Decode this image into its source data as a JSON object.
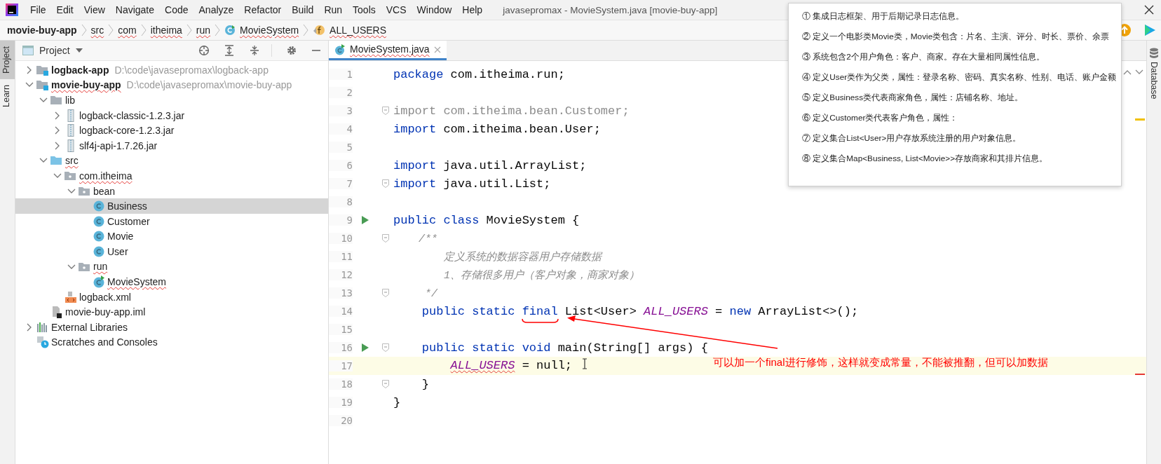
{
  "window": {
    "title": "javasepromax - MovieSystem.java [movie-buy-app]"
  },
  "menu": [
    "File",
    "Edit",
    "View",
    "Navigate",
    "Code",
    "Analyze",
    "Refactor",
    "Build",
    "Run",
    "Tools",
    "VCS",
    "Window",
    "Help"
  ],
  "breadcrumbs": [
    {
      "label": "movie-buy-app",
      "kind": "project",
      "error": false
    },
    {
      "label": "src",
      "kind": "dir",
      "error": true
    },
    {
      "label": "com",
      "kind": "dir",
      "error": true
    },
    {
      "label": "itheima",
      "kind": "dir",
      "error": true
    },
    {
      "label": "run",
      "kind": "dir",
      "error": true
    },
    {
      "label": "MovieSystem",
      "kind": "class",
      "error": true
    },
    {
      "label": "ALL_USERS",
      "kind": "field",
      "error": true
    }
  ],
  "left_stripe": [
    {
      "label": "Project",
      "selected": true
    },
    {
      "label": "Learn",
      "selected": false
    }
  ],
  "project_panel": {
    "title": "Project",
    "tree": [
      {
        "label": "logback-app",
        "path": "D:\\code\\javasepromax\\logback-app",
        "kind": "module",
        "expanded": false,
        "selected": false,
        "error": false
      },
      {
        "label": "movie-buy-app",
        "path": "D:\\code\\javasepromax\\movie-buy-app",
        "kind": "module",
        "expanded": true,
        "selected": false,
        "error": true,
        "children": [
          {
            "label": "lib",
            "kind": "folder",
            "expanded": true,
            "selected": false,
            "error": false,
            "children": [
              {
                "label": "logback-classic-1.2.3.jar",
                "kind": "jar",
                "expanded": false,
                "selected": false,
                "error": false
              },
              {
                "label": "logback-core-1.2.3.jar",
                "kind": "jar",
                "expanded": false,
                "selected": false,
                "error": false
              },
              {
                "label": "slf4j-api-1.7.26.jar",
                "kind": "jar",
                "expanded": false,
                "selected": false,
                "error": false
              }
            ]
          },
          {
            "label": "src",
            "kind": "source-folder",
            "expanded": true,
            "selected": false,
            "error": true,
            "children": [
              {
                "label": "com.itheima",
                "kind": "package",
                "expanded": true,
                "selected": false,
                "error": true,
                "children": [
                  {
                    "label": "bean",
                    "kind": "package",
                    "expanded": true,
                    "selected": false,
                    "error": false,
                    "children": [
                      {
                        "label": "Business",
                        "kind": "class",
                        "selected": true,
                        "error": false
                      },
                      {
                        "label": "Customer",
                        "kind": "class",
                        "selected": false,
                        "error": false
                      },
                      {
                        "label": "Movie",
                        "kind": "class",
                        "selected": false,
                        "error": false
                      },
                      {
                        "label": "User",
                        "kind": "class",
                        "selected": false,
                        "error": false
                      }
                    ]
                  },
                  {
                    "label": "run",
                    "kind": "package",
                    "expanded": true,
                    "selected": false,
                    "error": true,
                    "children": [
                      {
                        "label": "MovieSystem",
                        "kind": "main-class",
                        "selected": false,
                        "error": true
                      }
                    ]
                  }
                ]
              },
              {
                "label": "logback.xml",
                "kind": "xml",
                "selected": false,
                "error": false
              }
            ]
          },
          {
            "label": "movie-buy-app.iml",
            "kind": "iml",
            "selected": false,
            "error": false
          }
        ]
      },
      {
        "label": "External Libraries",
        "kind": "libraries",
        "expanded": false,
        "selected": false,
        "error": false
      },
      {
        "label": "Scratches and Consoles",
        "kind": "scratches",
        "selected": false,
        "error": false
      }
    ]
  },
  "editor": {
    "tabs": [
      {
        "label": "MovieSystem.java",
        "selected": true,
        "error": true
      }
    ],
    "lines": [
      {
        "number": "1",
        "kind": "code",
        "run": false,
        "fold": false,
        "current": false,
        "tokens": [
          {
            "t": "package",
            "kind": "keyword"
          },
          {
            "t": " com.itheima.run;",
            "kind": "plain"
          }
        ]
      },
      {
        "number": "2",
        "kind": "blank",
        "run": false,
        "fold": false,
        "current": false
      },
      {
        "number": "3",
        "kind": "code",
        "run": false,
        "fold": true,
        "current": false,
        "tokens": [
          {
            "t": "import com.itheima.bean.Customer;",
            "kind": "unused"
          }
        ]
      },
      {
        "number": "4",
        "kind": "code",
        "run": false,
        "fold": false,
        "current": false,
        "tokens": [
          {
            "t": "import",
            "kind": "keyword"
          },
          {
            "t": " com.itheima.bean.User;",
            "kind": "plain"
          }
        ]
      },
      {
        "number": "5",
        "kind": "blank",
        "run": false,
        "fold": false,
        "current": false
      },
      {
        "number": "6",
        "kind": "code",
        "run": false,
        "fold": false,
        "current": false,
        "tokens": [
          {
            "t": "import",
            "kind": "keyword"
          },
          {
            "t": " java.util.ArrayList;",
            "kind": "plain"
          }
        ]
      },
      {
        "number": "7",
        "kind": "code",
        "run": false,
        "fold": true,
        "current": false,
        "tokens": [
          {
            "t": "import",
            "kind": "keyword"
          },
          {
            "t": " java.util.List;",
            "kind": "plain"
          }
        ]
      },
      {
        "number": "8",
        "kind": "blank",
        "run": false,
        "fold": false,
        "current": false
      },
      {
        "number": "9",
        "kind": "code",
        "run": true,
        "fold": false,
        "current": false,
        "tokens": [
          {
            "t": "public class",
            "kind": "keyword"
          },
          {
            "t": " MovieSystem {",
            "kind": "plain"
          }
        ]
      },
      {
        "number": "10",
        "kind": "code",
        "run": false,
        "fold": true,
        "current": false,
        "tokens": [
          {
            "t": "    /**",
            "kind": "comment"
          }
        ]
      },
      {
        "number": "11",
        "kind": "code",
        "run": false,
        "fold": false,
        "current": false,
        "tokens": [
          {
            "t": "        定义系统的数据容器用户存储数据",
            "kind": "comment"
          }
        ]
      },
      {
        "number": "12",
        "kind": "code",
        "run": false,
        "fold": false,
        "current": false,
        "tokens": [
          {
            "t": "        1、存储很多用户（客户对象，商家对象）",
            "kind": "comment"
          }
        ]
      },
      {
        "number": "13",
        "kind": "code",
        "run": false,
        "fold": true,
        "current": false,
        "tokens": [
          {
            "t": "     */",
            "kind": "comment"
          }
        ]
      },
      {
        "number": "14",
        "kind": "code",
        "run": false,
        "fold": false,
        "current": false,
        "tokens": [
          {
            "t": "    public static ",
            "kind": "keyword"
          },
          {
            "t": "final",
            "kind": "keyword"
          },
          {
            "t": " List<User> ",
            "kind": "plain"
          },
          {
            "t": "ALL_USERS",
            "kind": "field"
          },
          {
            "t": " = ",
            "kind": "plain"
          },
          {
            "t": "new",
            "kind": "keyword"
          },
          {
            "t": " ArrayList<>();",
            "kind": "plain"
          }
        ]
      },
      {
        "number": "15",
        "kind": "blank",
        "run": false,
        "fold": false,
        "current": false
      },
      {
        "number": "16",
        "kind": "code",
        "run": true,
        "fold": true,
        "current": false,
        "tokens": [
          {
            "t": "    public static void",
            "kind": "keyword"
          },
          {
            "t": " main(String[] args) {",
            "kind": "plain"
          }
        ]
      },
      {
        "number": "17",
        "kind": "statement",
        "run": false,
        "fold": false,
        "current": true,
        "tokens": [
          {
            "t": "ALL_USERS",
            "kind": "field-error"
          },
          {
            "t": " = null;",
            "kind": "plain"
          }
        ]
      },
      {
        "number": "18",
        "kind": "code",
        "run": false,
        "fold": true,
        "current": false,
        "tokens": [
          {
            "t": "    }",
            "kind": "plain"
          }
        ]
      },
      {
        "number": "19",
        "kind": "code",
        "run": false,
        "fold": false,
        "current": false,
        "tokens": [
          {
            "t": "}",
            "kind": "plain"
          }
        ]
      },
      {
        "number": "20",
        "kind": "blank",
        "run": false,
        "fold": false,
        "current": false
      }
    ]
  },
  "annotation": {
    "text": "可以加一个final进行修饰，这样就变成常量，不能被推翻，但可以加数据"
  },
  "popup": {
    "items": [
      "① 集成日志框架、用于后期记录日志信息。",
      "② 定义一个电影类Movie类，Movie类包含：片名、主演、评分、时长、票价、余票",
      "③ 系统包含2个用户角色：客户、商家。存在大量相同属性信息。",
      "④ 定义User类作为父类，属性：登录名称、密码、真实名称、性别、电话、账户金额",
      "⑤ 定义Business类代表商家角色，属性：店铺名称、地址。",
      "⑥ 定义Customer类代表客户角色，属性：",
      "⑦ 定义集合List<User>用户存放系统注册的用户对象信息。",
      "⑧ 定义集合Map<Business, List<Movie>>存放商家和其排片信息。"
    ]
  },
  "right_stripe": [
    {
      "label": "Database"
    }
  ]
}
